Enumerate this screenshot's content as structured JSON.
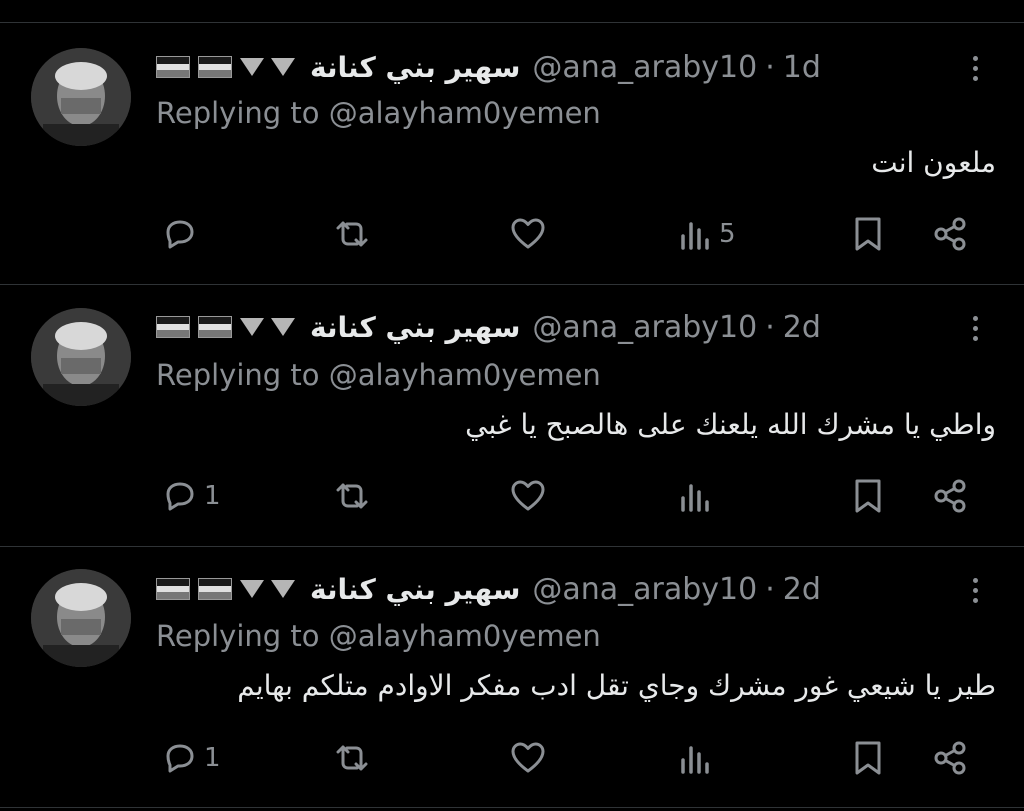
{
  "tweets": [
    {
      "name": "سهير بني كنانة",
      "handle": "@ana_araby10",
      "separator": "·",
      "time": "1d",
      "replying_label": "Replying to",
      "replying_to": "@alayham0yemen",
      "text": "ملعون انت",
      "reply_count": "",
      "views_count": "5"
    },
    {
      "name": "سهير بني كنانة",
      "handle": "@ana_araby10",
      "separator": "·",
      "time": "2d",
      "replying_label": "Replying to",
      "replying_to": "@alayham0yemen",
      "text": "واطي يا مشرك الله يلعنك على هالصبح يا غبي",
      "reply_count": "1",
      "views_count": ""
    },
    {
      "name": "سهير بني كنانة",
      "handle": "@ana_araby10",
      "separator": "·",
      "time": "2d",
      "replying_label": "Replying to",
      "replying_to": "@alayham0yemen",
      "text": "طير يا شيعي غور مشرك وجاي تقل ادب مفكر الاوادم متلكم بهايم",
      "reply_count": "1",
      "views_count": ""
    }
  ],
  "icons": {
    "reply": "reply-icon",
    "retweet": "retweet-icon",
    "like": "heart-icon",
    "views": "views-chart-icon",
    "bookmark": "bookmark-icon",
    "share": "share-icon",
    "more": "more-vertical-icon"
  },
  "colors": {
    "background": "#000000",
    "text": "#e7e9ea",
    "secondary": "#8b8f94",
    "divider": "#2f3336"
  }
}
